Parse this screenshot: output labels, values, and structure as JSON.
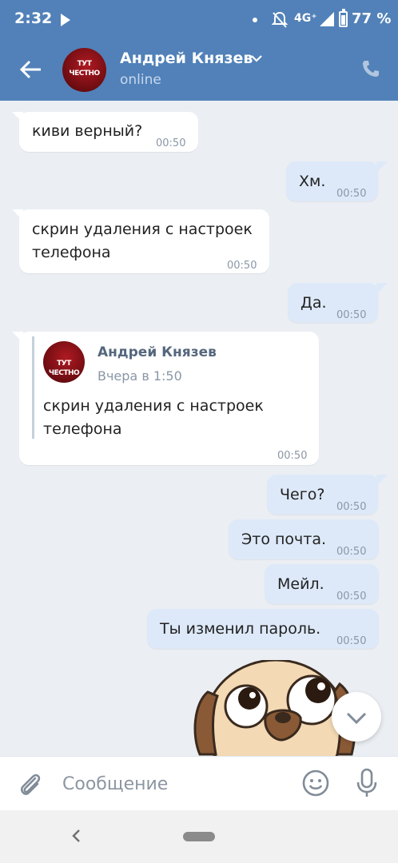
{
  "status_bar": {
    "time": "2:32",
    "network": "4G⁺",
    "battery": "77 %",
    "battery_level": 0.77
  },
  "header": {
    "contact_name": "Андрей Князев",
    "status": "online",
    "avatar_line1": "ТУТ",
    "avatar_line2": "ЧЕСТНО"
  },
  "messages": [
    {
      "direction": "in",
      "text": "киви верный?",
      "time": "00:50"
    },
    {
      "direction": "out",
      "text": "Хм.",
      "time": "00:50"
    },
    {
      "direction": "in",
      "text_line1": "скрин удаления с настроек",
      "text_line2": "телефона",
      "time": "00:50"
    },
    {
      "direction": "out",
      "text": "Да.",
      "time": "00:50"
    },
    {
      "direction": "in",
      "forwarded": {
        "author": "Андрей Князев",
        "date": "Вчера в 1:50",
        "avatar_line1": "ТУТ",
        "avatar_line2": "ЧЕСТНО",
        "text_line1": "скрин удаления с настроек",
        "text_line2": "телефона"
      },
      "time": "00:50"
    },
    {
      "direction": "out",
      "text": "Чего?",
      "time": "00:50"
    },
    {
      "direction": "out",
      "text": "Это почта.",
      "time": "00:50"
    },
    {
      "direction": "out",
      "text": "Мейл.",
      "time": "00:50"
    },
    {
      "direction": "out",
      "text": "Ты изменил пароль.",
      "time": "00:50"
    }
  ],
  "composer": {
    "placeholder": "Сообщение"
  },
  "icons": [
    "back-arrow-icon",
    "chevron-down-icon",
    "phone-icon",
    "attach-icon",
    "emoji-icon",
    "mic-icon",
    "scroll-down-icon"
  ],
  "colors": {
    "header": "#5181b8",
    "background": "#ebeef3",
    "incoming_bubble": "#ffffff",
    "outgoing_bubble": "#dde9f8"
  }
}
